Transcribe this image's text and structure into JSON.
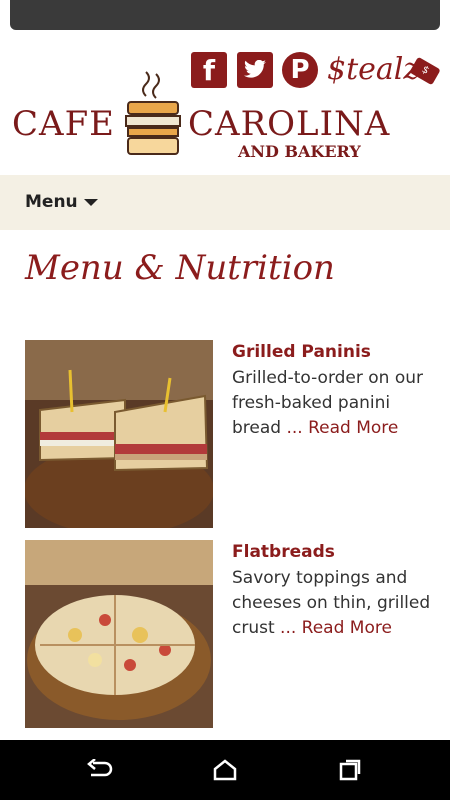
{
  "header": {
    "social": [
      "facebook-icon",
      "twitter-icon",
      "pinterest-icon"
    ],
    "stealz_label": "$tealz",
    "logo": {
      "left": "CAFE",
      "right": "CAROLINA",
      "sub": "AND BAKERY"
    }
  },
  "menu": {
    "label": "Menu"
  },
  "page": {
    "title": "Menu & Nutrition"
  },
  "items": [
    {
      "name": "Grilled Paninis",
      "desc": "Grilled-to-order on our fresh-baked panini bread",
      "more": "... Read More"
    },
    {
      "name": "Flatbreads",
      "desc": "Savory toppings and cheeses on thin, grilled crust",
      "more": "... Read More"
    }
  ],
  "colors": {
    "brand": "#8b1c1c",
    "menubar": "#f4f0e4"
  }
}
